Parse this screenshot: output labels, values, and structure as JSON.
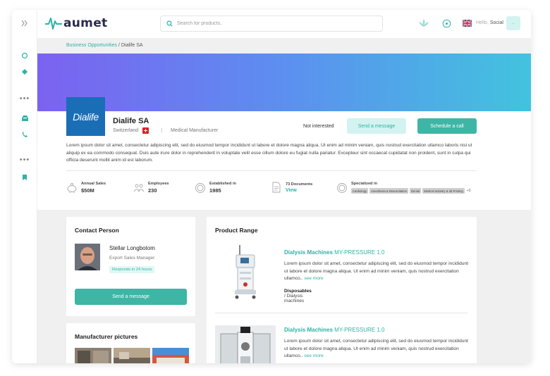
{
  "topbar": {
    "logo_text": "aumet",
    "search_placeholder": "Search for products..",
    "hello_prefix": "Hello,",
    "user_name": "Social",
    "avatar_label": "..."
  },
  "breadcrumb": {
    "parent": "Business Opportunities",
    "separator": " / ",
    "current": "Dialife SA"
  },
  "company": {
    "logo_text": "Dialife",
    "name": "Dialife SA",
    "country": "Switzerland",
    "separator": "|",
    "type": "Medical Manufacturer",
    "description": "Lorem ipsum dolor sit amet, consectetur adipiscing elit, sed do eiusmod tempor incididunt ut labore et dolore magna aliqua. Ut enim ad minim veniam, quis nostrud exercitation ullamco laboris nisi ut aliquip ex ea commodo consequat. Duis aute irure dolor in reprehenderit in voluptate velit esse cillum dolore eu fugiat nulla pariatur. Excepteur sint occaecat cupidatat non proident, sunt in culpa qui officia deserunt mollit anim id est laborum."
  },
  "actions": {
    "not_interested": "Not interested",
    "send_message": "Send a message",
    "schedule_call": "Schedule a call"
  },
  "stats": {
    "sales_label": "Annual Sales",
    "sales_value": "$50M",
    "employees_label": "Employees",
    "employees_value": "230",
    "established_label": "Established in",
    "established_value": "1985",
    "documents_label": "73 Documents",
    "documents_link": "View",
    "specialized_label": "Specialized in",
    "specialties": [
      "Cardiology",
      "Anesthesia & Resuscitation",
      "Dental",
      "Medical Industry & 3d Printing"
    ],
    "specialties_more": "+3"
  },
  "contact": {
    "title": "Contact Person",
    "name": "Stellar Longbotom",
    "role": "Export Sales Manager",
    "response": "Responds in 24 hours",
    "button": "Send a message"
  },
  "pictures": {
    "title": "Manufacturer pictures"
  },
  "products": {
    "title": "Product Range",
    "items": [
      {
        "name": "Dialysis Machines",
        "model": "MY-PRESSURE 1.0",
        "description": "Lorem ipsum dolor sit amet, consectetur adipiscing elit, sed do eiusmod tempor incididunt ut labore et dolore magna aliqua. Ut enim ad minim veniam, quis nostrud exercitation ullamco..",
        "more": "see more",
        "category": "Disposables",
        "category_sep": " / ",
        "subcategory": "Dialysis machines"
      },
      {
        "name": "Dialysis Machines",
        "model": "MY-PRESSURE 1.0",
        "description": "Lorem ipsum dolor sit amet, consectetur adipiscing elit, sed do eiusmod tempor incididunt ut labore et dolore magna aliqua. Ut enim ad minim veniam, quis nostrud exercitation ullamco..",
        "more": "see more"
      }
    ]
  },
  "colors": {
    "accent": "#3fb5a5",
    "accent_light": "#d3f3f0",
    "logo_blue": "#1a6eb6",
    "hero_start": "#7b62f0",
    "hero_end": "#42c3de"
  }
}
